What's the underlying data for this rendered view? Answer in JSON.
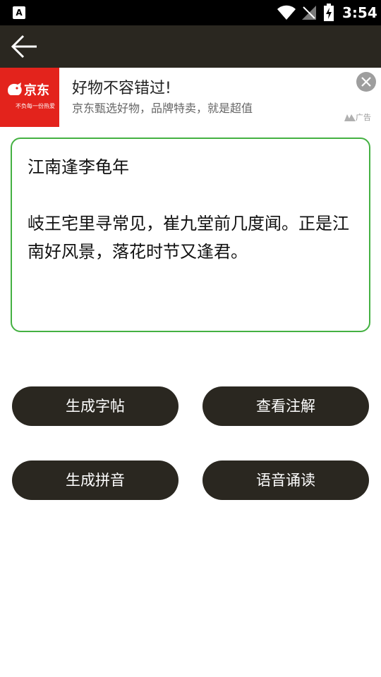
{
  "status_bar": {
    "app_badge": "A",
    "time": "3:54",
    "icons": [
      "wifi-icon",
      "no-signal-icon",
      "battery-charging-icon"
    ]
  },
  "toolbar": {
    "back_icon": "arrow-left-icon"
  },
  "ad": {
    "brand": "京东",
    "slogan": "不负每一份热爱",
    "title": "好物不容错过!",
    "description": "京东甄选好物，品牌特卖，就是超值",
    "tag": "广告",
    "close_icon": "close-icon",
    "brand_color": "#e3231c"
  },
  "poem": {
    "text": "江南逢李龟年\n\n岐王宅里寻常见，崔九堂前几度闻。正是江南好风景，落花时节又逢君。"
  },
  "buttons": {
    "copybook": "生成字帖",
    "annotation": "查看注解",
    "pinyin": "生成拼音",
    "read_aloud": "语音诵读"
  },
  "colors": {
    "accent_border": "#44b142",
    "button_bg": "#2a2720",
    "toolbar_bg": "#2a2720"
  }
}
